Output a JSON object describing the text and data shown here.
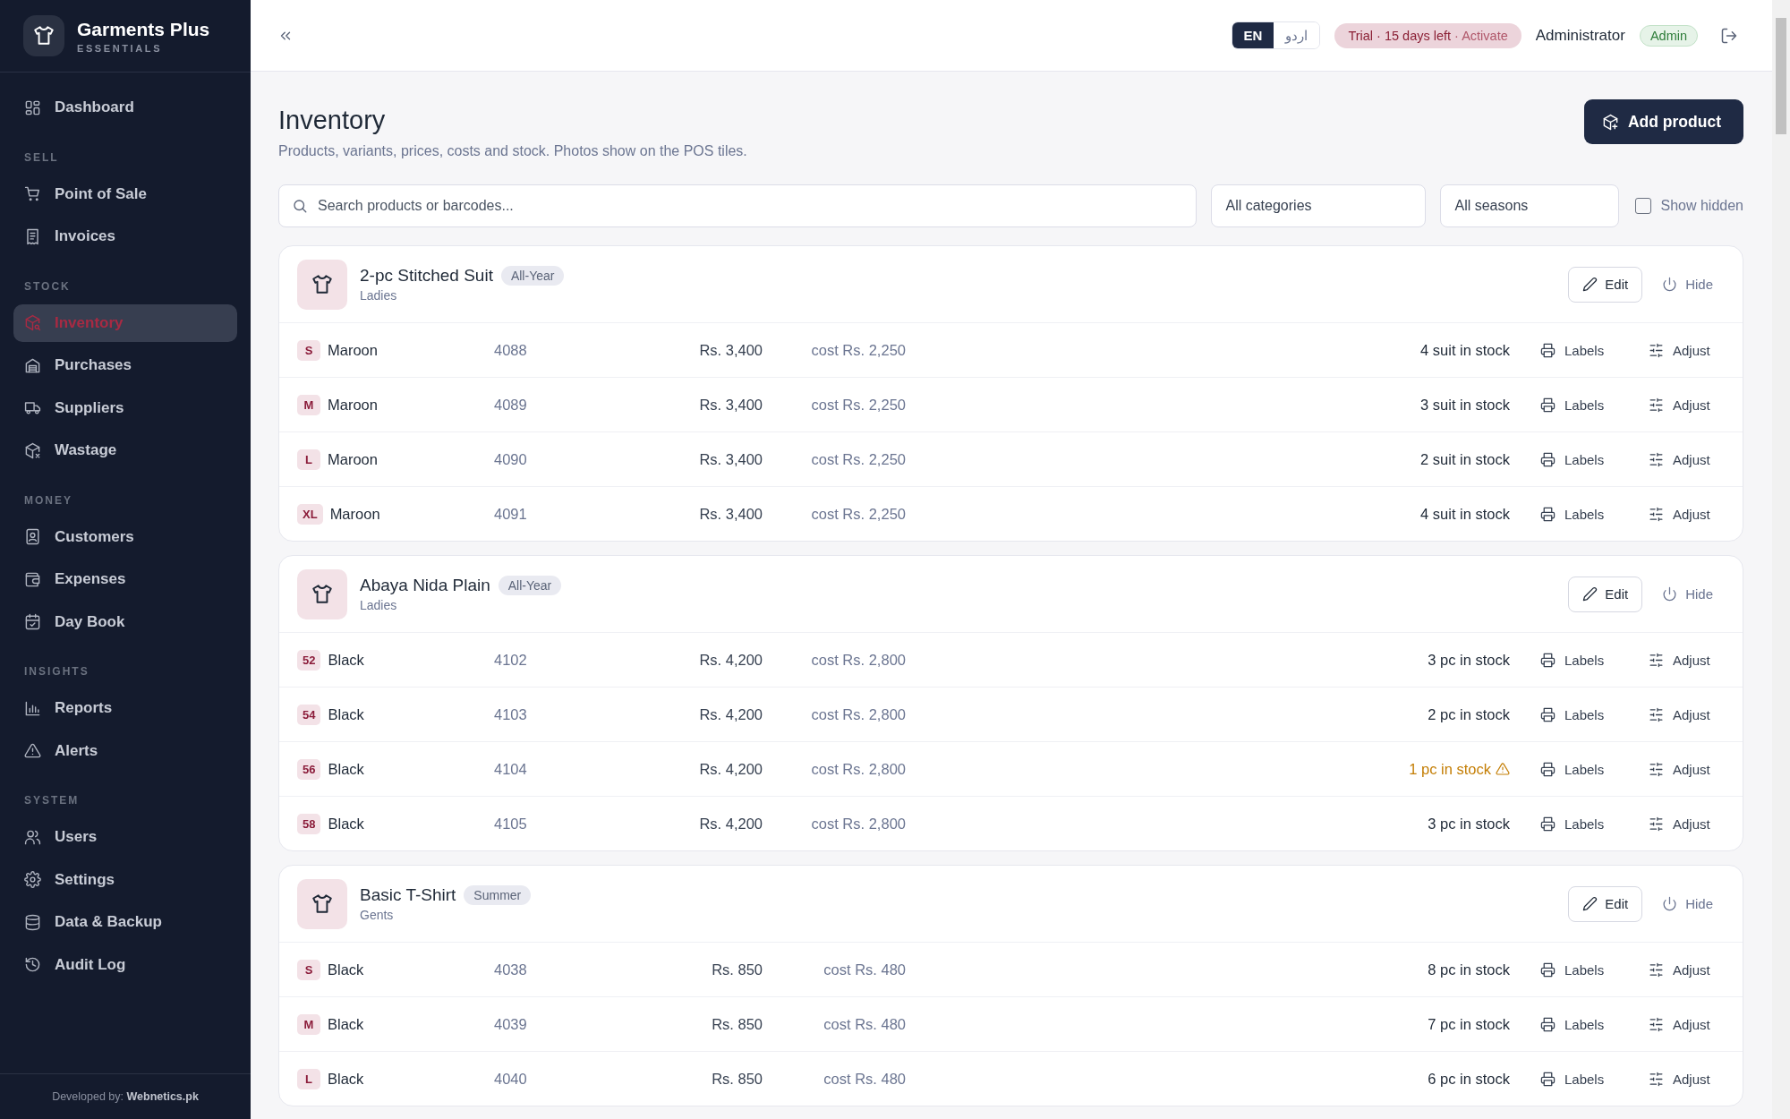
{
  "sidebar": {
    "brand": {
      "name": "Garments Plus",
      "tagline": "ESSENTIALS"
    },
    "items": [
      {
        "label": "Dashboard",
        "selected": false
      }
    ],
    "sections": [
      {
        "title": "SELL",
        "items": [
          {
            "label": "Point of Sale",
            "selected": false
          },
          {
            "label": "Invoices",
            "selected": false
          }
        ]
      },
      {
        "title": "STOCK",
        "items": [
          {
            "label": "Inventory",
            "selected": true
          },
          {
            "label": "Purchases",
            "selected": false
          },
          {
            "label": "Suppliers",
            "selected": false
          },
          {
            "label": "Wastage",
            "selected": false
          }
        ]
      },
      {
        "title": "MONEY",
        "items": [
          {
            "label": "Customers",
            "selected": false
          },
          {
            "label": "Expenses",
            "selected": false
          },
          {
            "label": "Day Book",
            "selected": false
          }
        ]
      },
      {
        "title": "INSIGHTS",
        "items": [
          {
            "label": "Reports",
            "selected": false
          },
          {
            "label": "Alerts",
            "selected": false
          }
        ]
      },
      {
        "title": "SYSTEM",
        "items": [
          {
            "label": "Users",
            "selected": false
          },
          {
            "label": "Settings",
            "selected": false
          },
          {
            "label": "Data & Backup",
            "selected": false
          },
          {
            "label": "Audit Log",
            "selected": false
          }
        ]
      }
    ],
    "footer": "Developed by: **Webnetics.pk**"
  },
  "header": {
    "languages": [
      {
        "label": "EN",
        "selected": true
      },
      {
        "label": "اردو",
        "selected": false
      }
    ],
    "trial": {
      "text": "Trial · 15 days left",
      "action": "· Activate"
    },
    "user": "Administrator",
    "role": "Admin"
  },
  "page": {
    "title": "Inventory",
    "subtitle": "Products, variants, prices, costs and stock. Photos show on the POS tiles.",
    "add_button": "Add product"
  },
  "filters": {
    "search": {
      "placeholder": "Search products or barcodes..."
    },
    "category": "All categories",
    "season": "All seasons",
    "show_hidden": {
      "label": "Show hidden",
      "checked": false
    }
  },
  "products": [
    {
      "name": "2-pc Stitched Suit",
      "season": "All-Year",
      "category": "Ladies",
      "edit": "Edit",
      "hide": "Hide",
      "variants": [
        {
          "size": "S",
          "variant": "Maroon",
          "code": "4088",
          "price": "Rs. 3,400",
          "cost": "cost Rs. 2,250",
          "stock": "4 suit in stock",
          "low": false,
          "labels": "Labels",
          "adjust": "Adjust"
        },
        {
          "size": "M",
          "variant": "Maroon",
          "code": "4089",
          "price": "Rs. 3,400",
          "cost": "cost Rs. 2,250",
          "stock": "3 suit in stock",
          "low": false,
          "labels": "Labels",
          "adjust": "Adjust"
        },
        {
          "size": "L",
          "variant": "Maroon",
          "code": "4090",
          "price": "Rs. 3,400",
          "cost": "cost Rs. 2,250",
          "stock": "2 suit in stock",
          "low": false,
          "labels": "Labels",
          "adjust": "Adjust"
        },
        {
          "size": "XL",
          "variant": "Maroon",
          "code": "4091",
          "price": "Rs. 3,400",
          "cost": "cost Rs. 2,250",
          "stock": "4 suit in stock",
          "low": false,
          "labels": "Labels",
          "adjust": "Adjust"
        }
      ]
    },
    {
      "name": "Abaya Nida Plain",
      "season": "All-Year",
      "category": "Ladies",
      "edit": "Edit",
      "hide": "Hide",
      "variants": [
        {
          "size": "52",
          "variant": "Black",
          "code": "4102",
          "price": "Rs. 4,200",
          "cost": "cost Rs. 2,800",
          "stock": "3 pc in stock",
          "low": false,
          "labels": "Labels",
          "adjust": "Adjust"
        },
        {
          "size": "54",
          "variant": "Black",
          "code": "4103",
          "price": "Rs. 4,200",
          "cost": "cost Rs. 2,800",
          "stock": "2 pc in stock",
          "low": false,
          "labels": "Labels",
          "adjust": "Adjust"
        },
        {
          "size": "56",
          "variant": "Black",
          "code": "4104",
          "price": "Rs. 4,200",
          "cost": "cost Rs. 2,800",
          "stock": "1 pc in stock",
          "low": true,
          "labels": "Labels",
          "adjust": "Adjust"
        },
        {
          "size": "58",
          "variant": "Black",
          "code": "4105",
          "price": "Rs. 4,200",
          "cost": "cost Rs. 2,800",
          "stock": "3 pc in stock",
          "low": false,
          "labels": "Labels",
          "adjust": "Adjust"
        }
      ]
    },
    {
      "name": "Basic T-Shirt",
      "season": "Summer",
      "category": "Gents",
      "edit": "Edit",
      "hide": "Hide",
      "variants": [
        {
          "size": "S",
          "variant": "Black",
          "code": "4038",
          "price": "Rs. 850",
          "cost": "cost Rs. 480",
          "stock": "8 pc in stock",
          "low": false,
          "labels": "Labels",
          "adjust": "Adjust"
        },
        {
          "size": "M",
          "variant": "Black",
          "code": "4039",
          "price": "Rs. 850",
          "cost": "cost Rs. 480",
          "stock": "7 pc in stock",
          "low": false,
          "labels": "Labels",
          "adjust": "Adjust"
        },
        {
          "size": "L",
          "variant": "Black",
          "code": "4040",
          "price": "Rs. 850",
          "cost": "cost Rs. 480",
          "stock": "6 pc in stock",
          "low": false,
          "labels": "Labels",
          "adjust": "Adjust"
        }
      ]
    }
  ]
}
